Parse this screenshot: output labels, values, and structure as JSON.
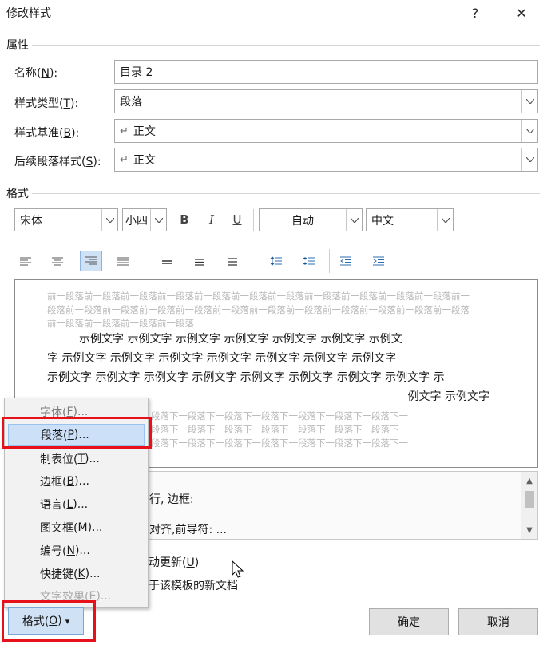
{
  "window": {
    "title": "修改样式",
    "help_glyph": "?",
    "close_glyph": "✕"
  },
  "properties": {
    "heading": "属性",
    "name_label": "名称(",
    "name_key": "N",
    "name_label_end": "):",
    "name_value": "目录 2",
    "type_label": "样式类型(",
    "type_key": "T",
    "type_label_end": "):",
    "type_value": "段落",
    "based_label": "样式基准(",
    "based_key": "B",
    "based_label_end": "):",
    "based_value": "正文",
    "next_label": "后续段落样式(",
    "next_key": "S",
    "next_label_end": "):",
    "next_value": "正文",
    "return_glyph": "↵"
  },
  "format": {
    "heading": "格式",
    "font": "宋体",
    "size": "小四",
    "bold": "B",
    "italic": "I",
    "underline": "U",
    "color": "自动",
    "script": "中文"
  },
  "preview": {
    "before_lines": [
      "前一段落前一段落前一段落前一段落前一段落前一段落前一段落前一段落前一段落前一段落前一段落前一",
      "段落前一段落前一段落前一段落前一段落前一段落前一段落前一段落前一段落前一段落前一段落前一段落",
      "前一段落前一段落前一段落前一段落"
    ],
    "sample_lines": [
      "示例文字  示例文字  示例文字  示例文字  示例文字  示例文字  示例文",
      "字  示例文字  示例文字  示例文字  示例文字  示例文字  示例文字  示例文字",
      "示例文字  示例文字  示例文字  示例文字  示例文字  示例文字  示例文字  示例文字  示",
      "例文字  示例文字"
    ],
    "after_lines": [
      "段落下一段落下一段落下一段落下一段落下一段落下一段落下一",
      "段落下一段落下一段落下一段落下一段落下一段落下一段落下一",
      "段落下一段落下一段落下一段落下一段落下一段落下一段落下一"
    ]
  },
  "description": {
    "line1": "行, 边框:",
    "line2": "对齐,前导符: ..."
  },
  "options": {
    "auto_update": "动更新(",
    "auto_update_key": "U",
    "auto_update_end": ")",
    "new_docs": "于该模板的新文档"
  },
  "menu": {
    "items": [
      {
        "label": "字体(",
        "key": "F",
        "end": ")..."
      },
      {
        "label": "段落(",
        "key": "P",
        "end": ")..."
      },
      {
        "label": "制表位(",
        "key": "T",
        "end": ")..."
      },
      {
        "label": "边框(",
        "key": "B",
        "end": ")..."
      },
      {
        "label": "语言(",
        "key": "L",
        "end": ")..."
      },
      {
        "label": "图文框(",
        "key": "M",
        "end": ")..."
      },
      {
        "label": "编号(",
        "key": "N",
        "end": ")..."
      },
      {
        "label": "快捷键(",
        "key": "K",
        "end": ")..."
      },
      {
        "label": "文字效果(",
        "key": "E",
        "end": ")..."
      }
    ]
  },
  "buttons": {
    "format_label": "格式(",
    "format_key": "O",
    "format_end": ")",
    "format_arrow": "▾",
    "ok": "确定",
    "cancel": "取消"
  },
  "colors": {
    "highlight": "#e8101b",
    "menu_highlight": "#cce0f7",
    "active_align": "#cfe1f5"
  }
}
